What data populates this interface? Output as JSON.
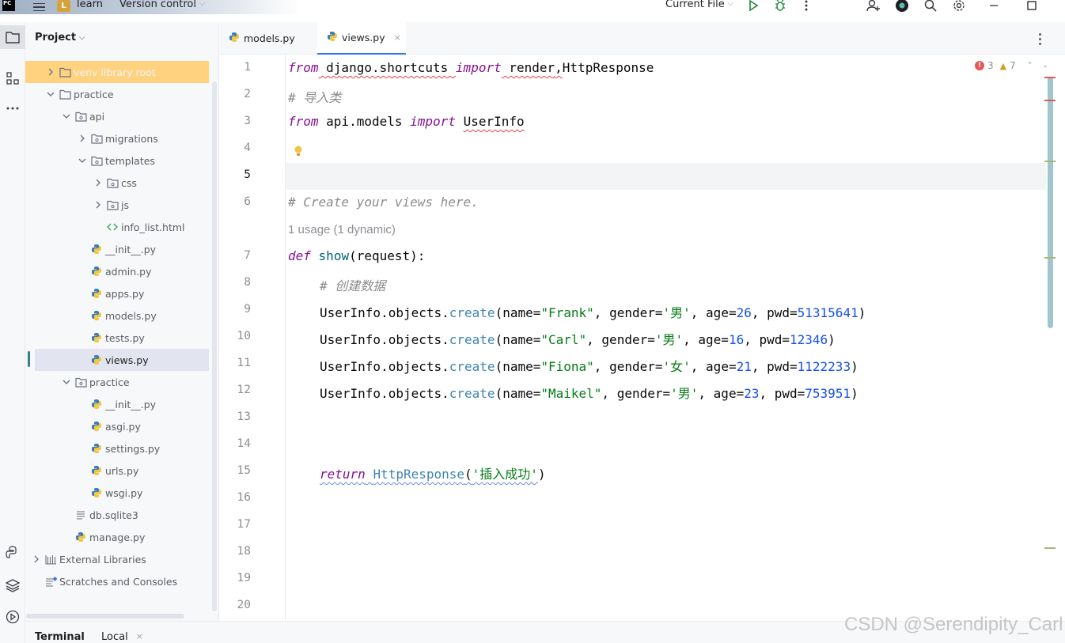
{
  "titlebar": {
    "logo": "PC",
    "project_badge": "L",
    "project_name": "learn",
    "vcs_label": "Version control",
    "run_config": "Current File"
  },
  "project_panel": {
    "title": "Project",
    "tree": [
      {
        "label": "venv  library root",
        "icon": "folder-icon",
        "chevron": "right"
      },
      {
        "label": "practice",
        "icon": "folder-icon",
        "chevron": "down"
      },
      {
        "label": "api",
        "icon": "package-folder-icon",
        "chevron": "down"
      },
      {
        "label": "migrations",
        "icon": "package-folder-icon",
        "chevron": "right"
      },
      {
        "label": "templates",
        "icon": "package-folder-icon",
        "chevron": "down"
      },
      {
        "label": "css",
        "icon": "package-folder-icon",
        "chevron": "right"
      },
      {
        "label": "js",
        "icon": "package-folder-icon",
        "chevron": "right"
      },
      {
        "label": "info_list.html",
        "icon": "html-icon",
        "chevron": ""
      },
      {
        "label": "__init__.py",
        "icon": "python-icon",
        "chevron": ""
      },
      {
        "label": "admin.py",
        "icon": "python-icon",
        "chevron": ""
      },
      {
        "label": "apps.py",
        "icon": "python-icon",
        "chevron": ""
      },
      {
        "label": "models.py",
        "icon": "python-icon",
        "chevron": ""
      },
      {
        "label": "tests.py",
        "icon": "python-icon",
        "chevron": ""
      },
      {
        "label": "views.py",
        "icon": "python-icon",
        "chevron": ""
      },
      {
        "label": "practice",
        "icon": "package-folder-icon",
        "chevron": "down"
      },
      {
        "label": "__init__.py",
        "icon": "python-icon",
        "chevron": ""
      },
      {
        "label": "asgi.py",
        "icon": "python-icon",
        "chevron": ""
      },
      {
        "label": "settings.py",
        "icon": "python-icon",
        "chevron": ""
      },
      {
        "label": "urls.py",
        "icon": "python-icon",
        "chevron": ""
      },
      {
        "label": "wsgi.py",
        "icon": "python-icon",
        "chevron": ""
      },
      {
        "label": "db.sqlite3",
        "icon": "text-file-icon",
        "chevron": ""
      },
      {
        "label": "manage.py",
        "icon": "python-icon",
        "chevron": ""
      },
      {
        "label": "External Libraries",
        "icon": "library-icon",
        "chevron": "right"
      },
      {
        "label": "Scratches and Consoles",
        "icon": "scratches-icon",
        "chevron": ""
      }
    ]
  },
  "tabs": [
    {
      "label": "models.py",
      "icon": "python-icon"
    },
    {
      "label": "views.py",
      "icon": "python-icon",
      "active": true,
      "close": "×"
    }
  ],
  "editor": {
    "errors": "3",
    "warnings": "7",
    "line_numbers": [
      "1",
      "2",
      "3",
      "4",
      "5",
      "6",
      "7",
      "8",
      "9",
      "10",
      "11",
      "12",
      "13",
      "14",
      "15",
      "16",
      "17",
      "18",
      "19",
      "20"
    ],
    "usage_hint": "1 usage (1 dynamic)",
    "code": {
      "l1": {
        "k1": "from",
        "mod": " django.shortcuts ",
        "k2": "import",
        "a": " render",
        "comma": ",",
        "b": "HttpResponse"
      },
      "l2": "# 导入类",
      "l3": {
        "k1": "from",
        "mod": " api.models ",
        "k2": "import",
        "a": " ",
        "b": "UserInfo"
      },
      "l6": "# Create your views here.",
      "l7": {
        "k": "def",
        "name": "show",
        "open": "(",
        "param": "request",
        "close": "):"
      },
      "l8": "# 创建数据",
      "creates": [
        {
          "name": "\"Frank\"",
          "gender": "'男'",
          "age": "26",
          "pwd": "51315641"
        },
        {
          "name": "\"Carl\"",
          "gender": "'男'",
          "age": "16",
          "pwd": "12346"
        },
        {
          "name": "\"Fiona\"",
          "gender": "'女'",
          "age": "21",
          "pwd": "1122233"
        },
        {
          "name": "\"Maikel\"",
          "gender": "'男'",
          "age": "23",
          "pwd": "753951"
        }
      ],
      "create_parts": {
        "obj": "UserInfo.objects.",
        "method": "create",
        "p_name": "(name=",
        "p_gender": ", gender=",
        "p_age": ", age=",
        "p_pwd": ", pwd=",
        "end": ")"
      },
      "l15": {
        "k": "return",
        "fn": "HttpResponse",
        "open": "(",
        "str": "'插入成功'",
        "close": ")"
      }
    }
  },
  "bottom": {
    "terminal": "Terminal",
    "local": "Local",
    "local_close": "×"
  },
  "watermark": "CSDN @Serendipity_Carl",
  "colors": {
    "keyword": "#871094",
    "string": "#067d17",
    "number": "#1750eb",
    "comment": "#8c8c8c",
    "venv_highlight": "#ffd27f",
    "selection": "#e2e5ef",
    "accent": "#3574f0"
  }
}
